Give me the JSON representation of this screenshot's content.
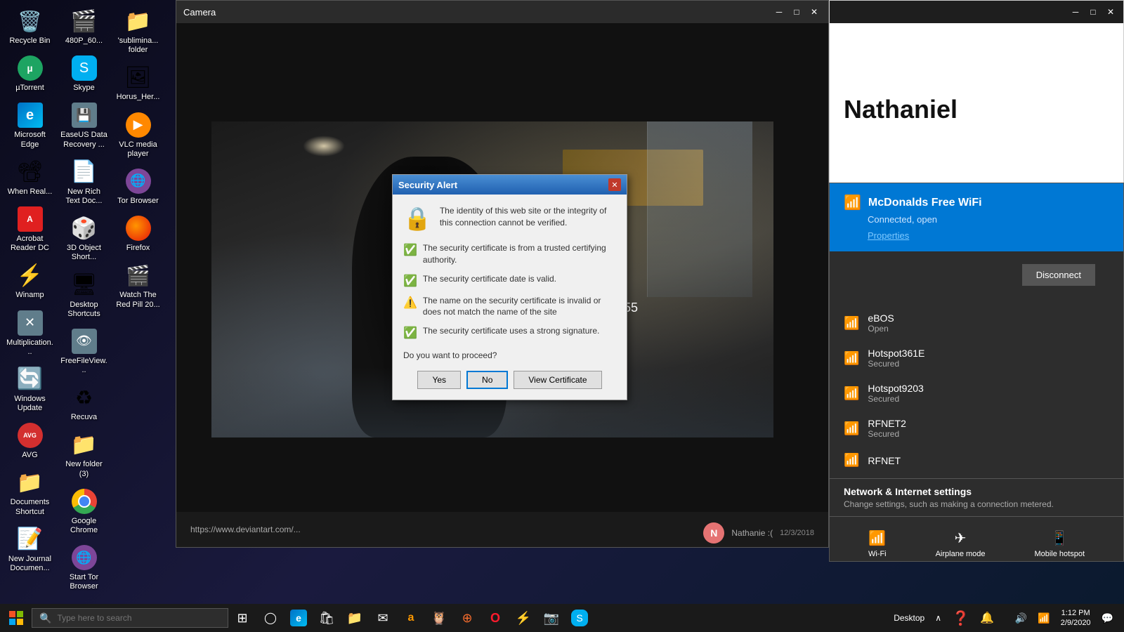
{
  "desktop": {
    "background_color": "#0a1428",
    "icons": [
      {
        "id": "recycle-bin",
        "label": "Recycle Bin",
        "icon_type": "recycle",
        "icon_char": "🗑"
      },
      {
        "id": "utorrent",
        "label": "µTorrent",
        "icon_type": "utorrent",
        "icon_char": "µ"
      },
      {
        "id": "microsoft-edge",
        "label": "Microsoft Edge",
        "icon_type": "edge",
        "icon_char": "e"
      },
      {
        "id": "when-real",
        "label": "When Real...",
        "icon_type": "generic",
        "icon_char": "📄"
      },
      {
        "id": "acrobat-reader",
        "label": "Acrobat Reader DC",
        "icon_type": "acrobat",
        "icon_char": "A"
      },
      {
        "id": "winamp",
        "label": "Winamp",
        "icon_type": "generic",
        "icon_char": "⚡"
      },
      {
        "id": "multiplication",
        "label": "Multiplication...",
        "icon_type": "generic",
        "icon_char": "✕"
      },
      {
        "id": "windows-update",
        "label": "Windows Update",
        "icon_type": "generic",
        "icon_char": "↻"
      },
      {
        "id": "avg",
        "label": "AVG",
        "icon_type": "avg",
        "icon_char": "AVG"
      },
      {
        "id": "documents-shortcut",
        "label": "Documents Shortcut",
        "icon_type": "folder",
        "icon_char": "📁"
      },
      {
        "id": "new-journal",
        "label": "New Journal Documen...",
        "icon_type": "generic",
        "icon_char": "📝"
      },
      {
        "id": "480p",
        "label": "480P_60...",
        "icon_type": "generic",
        "icon_char": "🎬"
      },
      {
        "id": "skype",
        "label": "Skype",
        "icon_type": "skype",
        "icon_char": "S"
      },
      {
        "id": "easeus",
        "label": "EaseUS Data Recovery ...",
        "icon_type": "generic",
        "icon_char": "💾"
      },
      {
        "id": "new-rich-text",
        "label": "New Rich Text Doc...",
        "icon_type": "generic",
        "icon_char": "📄"
      },
      {
        "id": "3d-object",
        "label": "3D Object Short...",
        "icon_type": "generic",
        "icon_char": "🎲"
      },
      {
        "id": "desktop-shortcuts",
        "label": "Desktop Shortcuts",
        "icon_type": "folder",
        "icon_char": "📁"
      },
      {
        "id": "freefileview",
        "label": "FreeFileView...",
        "icon_type": "generic",
        "icon_char": "👁"
      },
      {
        "id": "recuva",
        "label": "Recuva",
        "icon_type": "generic",
        "icon_char": "♻"
      },
      {
        "id": "new-folder-3",
        "label": "New folder (3)",
        "icon_type": "folder",
        "icon_char": "📁"
      },
      {
        "id": "google-chrome",
        "label": "Google Chrome",
        "icon_type": "chrome",
        "icon_char": ""
      },
      {
        "id": "start-tor-browser",
        "label": "Start Tor Browser",
        "icon_type": "tor",
        "icon_char": "🌐"
      },
      {
        "id": "subliminal-folder",
        "label": "'sublimina... folder",
        "icon_type": "folder",
        "icon_char": "📁"
      },
      {
        "id": "horus-hero",
        "label": "Horus_Her...",
        "icon_type": "generic",
        "icon_char": "🖼"
      },
      {
        "id": "vlc-media",
        "label": "VLC media player",
        "icon_type": "vlc",
        "icon_char": "▶"
      },
      {
        "id": "tor-browser",
        "label": "Tor Browser",
        "icon_type": "tor",
        "icon_char": "🌐"
      },
      {
        "id": "firefox",
        "label": "Firefox",
        "icon_type": "firefox",
        "icon_char": "🦊"
      },
      {
        "id": "watch-red-pill",
        "label": "Watch The Red Pill 20...",
        "icon_type": "generic",
        "icon_char": "🎬"
      }
    ]
  },
  "camera_window": {
    "title": "Camera",
    "recording_time": "00:55",
    "url": "https://www.deviantart.com/..."
  },
  "chat_window": {
    "user_name": "Nathaniel",
    "message_preview": "Nathanie :(",
    "timestamp": "12/3/2018"
  },
  "security_dialog": {
    "title": "Security Alert",
    "header_text": "The identity of this web site or the integrity of this connection cannot be verified.",
    "checks": [
      {
        "status": "ok",
        "text": "The security certificate is from a trusted certifying authority."
      },
      {
        "status": "ok",
        "text": "The security certificate date is valid."
      },
      {
        "status": "warn",
        "text": "The name on the security certificate is invalid or does not match the name of the site"
      },
      {
        "status": "ok",
        "text": "The security certificate uses a strong signature."
      }
    ],
    "question": "Do you want to proceed?",
    "buttons": {
      "yes": "Yes",
      "no": "No",
      "view_certificate": "View Certificate"
    }
  },
  "wifi_panel": {
    "connected_network": {
      "name": "McDonalds Free WiFi",
      "status": "Connected, open",
      "properties_link": "Properties",
      "disconnect_btn": "Disconnect"
    },
    "networks": [
      {
        "name": "eBOS",
        "security": "Open"
      },
      {
        "name": "Hotspot361E",
        "security": "Secured"
      },
      {
        "name": "Hotspot9203",
        "security": "Secured"
      },
      {
        "name": "RFNET2",
        "security": "Secured"
      },
      {
        "name": "RFNET",
        "security": ""
      }
    ],
    "network_settings": {
      "title": "Network & Internet settings",
      "subtitle": "Change settings, such as making a connection metered."
    },
    "bottom_buttons": [
      {
        "id": "wifi",
        "label": "Wi-Fi",
        "icon": "📶"
      },
      {
        "id": "airplane",
        "label": "Airplane mode",
        "icon": "✈"
      },
      {
        "id": "mobile-hotspot",
        "label": "Mobile hotspot",
        "icon": "📱"
      }
    ]
  },
  "taskbar": {
    "search_placeholder": "Type here to search",
    "desktop_label": "Desktop",
    "time": "1:12 PM",
    "date": "2/9/2020",
    "icons": [
      {
        "id": "task-view",
        "icon": "⊞"
      },
      {
        "id": "edge-tb",
        "icon": "e"
      },
      {
        "id": "store",
        "icon": "🛍"
      },
      {
        "id": "files",
        "icon": "📁"
      },
      {
        "id": "mail",
        "icon": "✉"
      },
      {
        "id": "amazon",
        "icon": "a"
      },
      {
        "id": "tripadvisor",
        "icon": "🦉"
      },
      {
        "id": "origin",
        "icon": "⭕"
      },
      {
        "id": "opera",
        "icon": "O"
      },
      {
        "id": "winamp-tb",
        "icon": "⚡"
      },
      {
        "id": "camera-tb",
        "icon": "📷"
      },
      {
        "id": "skype-tb",
        "icon": "S"
      }
    ]
  }
}
